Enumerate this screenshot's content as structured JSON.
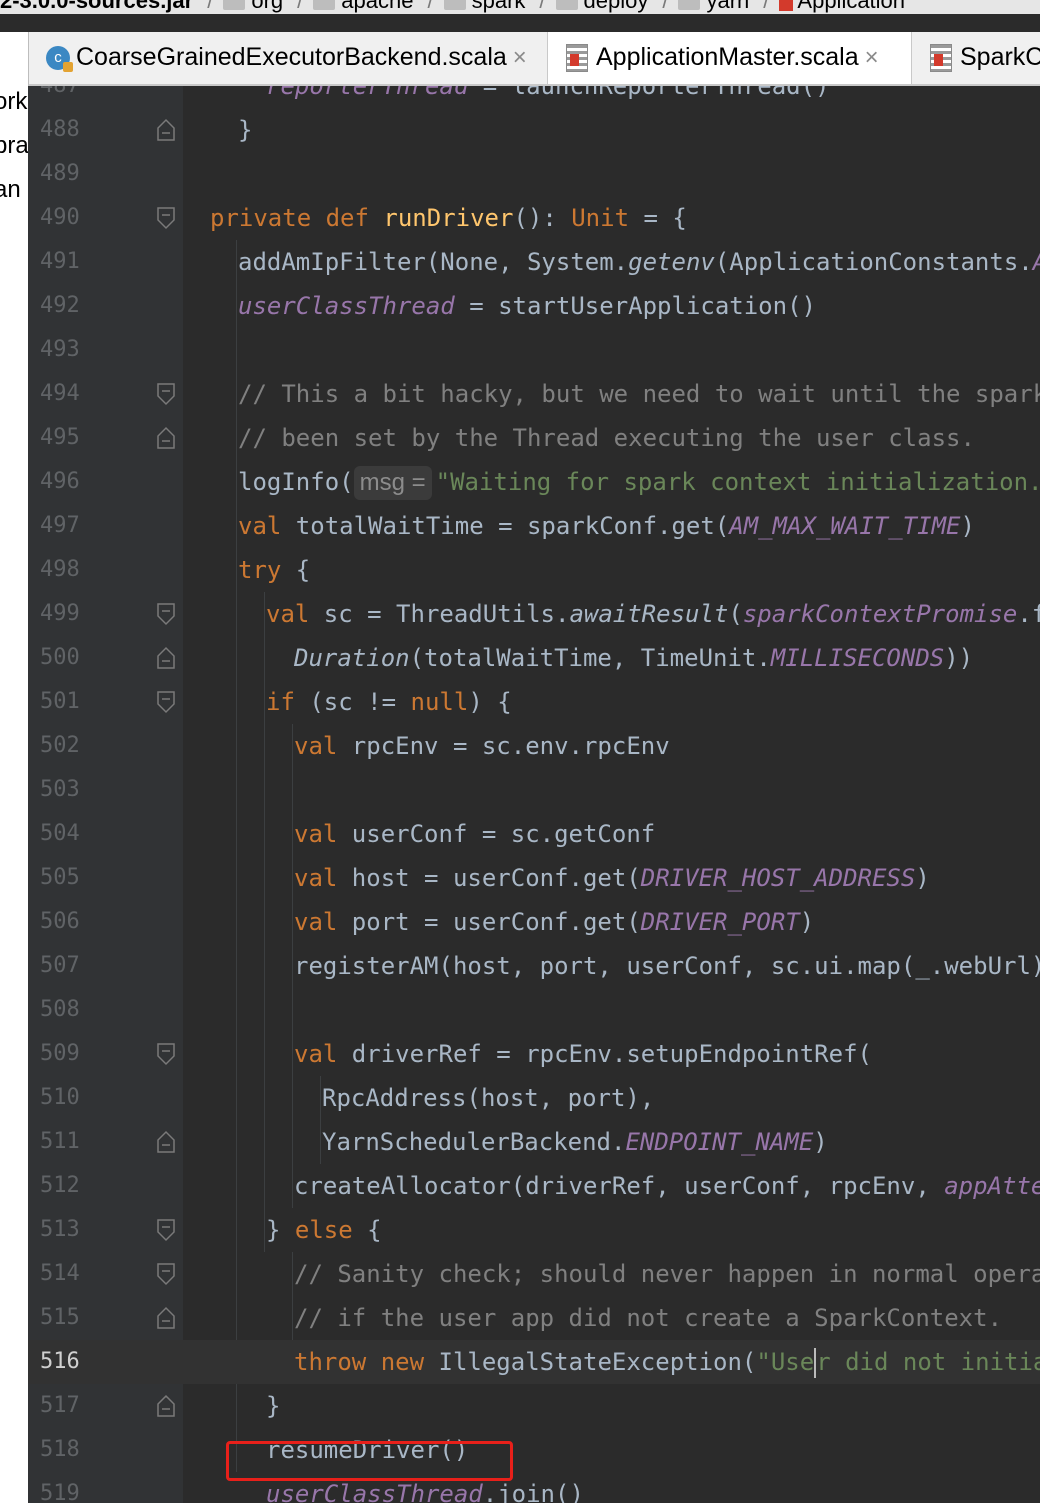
{
  "breadcrumb": {
    "items": [
      "2-3.0.0-sources.jar",
      "org",
      "apache",
      "spark",
      "deploy",
      "yarn",
      "Application"
    ]
  },
  "tabs": [
    {
      "label": "CoarseGrainedExecutorBackend.scala",
      "close": "×",
      "icon": "scala-class-icon",
      "active": false
    },
    {
      "label": "ApplicationMaster.scala",
      "close": "×",
      "icon": "scala-file-icon",
      "active": true
    },
    {
      "label": "SparkC",
      "close": "",
      "icon": "scala-file-icon",
      "active": false
    }
  ],
  "project_panel": {
    "fragments": [
      "ork",
      "bra",
      "an"
    ]
  },
  "editor": {
    "current_line": "516",
    "hint_label": "msg =",
    "lines": [
      {
        "n": "487",
        "segs": [
          [
            "fld",
            "reporterThread"
          ],
          [
            "",
            " = launchReporterThread()"
          ]
        ],
        "indent": 2
      },
      {
        "n": "488",
        "segs": [
          [
            "",
            "}"
          ]
        ],
        "indent": 1
      },
      {
        "n": "489",
        "segs": [],
        "indent": 0
      },
      {
        "n": "490",
        "segs": [
          [
            "kw",
            "private def "
          ],
          [
            "fn",
            "runDriver"
          ],
          [
            "",
            "(): "
          ],
          [
            "ty",
            "Unit"
          ],
          [
            "",
            " = {"
          ]
        ],
        "indent": 0
      },
      {
        "n": "491",
        "segs": [
          [
            "",
            "addAmIpFilter(None, System."
          ],
          [
            "it",
            "getenv"
          ],
          [
            "",
            "(ApplicationConstants."
          ],
          [
            "cst",
            "API"
          ]
        ],
        "indent": 1
      },
      {
        "n": "492",
        "segs": [
          [
            "fld",
            "userClassThread"
          ],
          [
            "",
            " = startUserApplication()"
          ]
        ],
        "indent": 1
      },
      {
        "n": "493",
        "segs": [],
        "indent": 1
      },
      {
        "n": "494",
        "segs": [
          [
            "cm",
            "// This a bit hacky, but we need to wait until the spark.d"
          ]
        ],
        "indent": 1
      },
      {
        "n": "495",
        "segs": [
          [
            "cm",
            "// been set by the Thread executing the user class."
          ]
        ],
        "indent": 1
      },
      {
        "n": "496",
        "segs": [
          [
            "",
            "logInfo("
          ],
          [
            "hint",
            "msg ="
          ],
          [
            "str",
            "\"Waiting for spark context initialization."
          ]
        ],
        "indent": 1
      },
      {
        "n": "497",
        "segs": [
          [
            "kw",
            "val "
          ],
          [
            "",
            "totalWaitTime = sparkConf.get("
          ],
          [
            "cst",
            "AM_MAX_WAIT_TIME"
          ],
          [
            "",
            ")"
          ]
        ],
        "indent": 1
      },
      {
        "n": "498",
        "segs": [
          [
            "kw",
            "try "
          ],
          [
            "",
            "{"
          ]
        ],
        "indent": 1
      },
      {
        "n": "499",
        "segs": [
          [
            "kw",
            "val "
          ],
          [
            "",
            "sc = ThreadUtils."
          ],
          [
            "it",
            "awaitResult"
          ],
          [
            "",
            "("
          ],
          [
            "fld",
            "sparkContextPromise"
          ],
          [
            "",
            ".fu"
          ]
        ],
        "indent": 2
      },
      {
        "n": "500",
        "segs": [
          [
            "it",
            "Duration"
          ],
          [
            "",
            "(totalWaitTime, TimeUnit."
          ],
          [
            "cst",
            "MILLISECONDS"
          ],
          [
            "",
            "))"
          ]
        ],
        "indent": 3
      },
      {
        "n": "501",
        "segs": [
          [
            "kw",
            "if "
          ],
          [
            "",
            "(sc != "
          ],
          [
            "kw",
            "null"
          ],
          [
            "",
            ") {"
          ]
        ],
        "indent": 2
      },
      {
        "n": "502",
        "segs": [
          [
            "kw",
            "val "
          ],
          [
            "",
            "rpcEnv = sc.env.rpcEnv"
          ]
        ],
        "indent": 3
      },
      {
        "n": "503",
        "segs": [],
        "indent": 3
      },
      {
        "n": "504",
        "segs": [
          [
            "kw",
            "val "
          ],
          [
            "",
            "userConf = sc.getConf"
          ]
        ],
        "indent": 3
      },
      {
        "n": "505",
        "segs": [
          [
            "kw",
            "val "
          ],
          [
            "",
            "host = userConf.get("
          ],
          [
            "cst",
            "DRIVER_HOST_ADDRESS"
          ],
          [
            "",
            ")"
          ]
        ],
        "indent": 3
      },
      {
        "n": "506",
        "segs": [
          [
            "kw",
            "val "
          ],
          [
            "",
            "port = userConf.get("
          ],
          [
            "cst",
            "DRIVER_PORT"
          ],
          [
            "",
            ")"
          ]
        ],
        "indent": 3
      },
      {
        "n": "507",
        "segs": [
          [
            "",
            "registerAM(host, port, userConf, sc.ui.map(_.webUrl),"
          ]
        ],
        "indent": 3
      },
      {
        "n": "508",
        "segs": [],
        "indent": 3
      },
      {
        "n": "509",
        "segs": [
          [
            "kw",
            "val "
          ],
          [
            "",
            "driverRef = rpcEnv.setupEndpointRef("
          ]
        ],
        "indent": 3
      },
      {
        "n": "510",
        "segs": [
          [
            "",
            "RpcAddress(host, port),"
          ]
        ],
        "indent": 4
      },
      {
        "n": "511",
        "segs": [
          [
            "",
            "YarnSchedulerBackend."
          ],
          [
            "cst",
            "ENDPOINT_NAME"
          ],
          [
            "",
            ")"
          ]
        ],
        "indent": 4
      },
      {
        "n": "512",
        "segs": [
          [
            "",
            "createAllocator(driverRef, userConf, rpcEnv, "
          ],
          [
            "fld",
            "appAttem"
          ]
        ],
        "indent": 3
      },
      {
        "n": "513",
        "segs": [
          [
            "",
            "} "
          ],
          [
            "kw",
            "else "
          ],
          [
            "",
            "{"
          ]
        ],
        "indent": 2
      },
      {
        "n": "514",
        "segs": [
          [
            "cm",
            "// Sanity check; should never happen in normal operati"
          ]
        ],
        "indent": 3
      },
      {
        "n": "515",
        "segs": [
          [
            "cm",
            "// if the user app did not create a SparkContext."
          ]
        ],
        "indent": 3
      },
      {
        "n": "516",
        "segs": [
          [
            "kw",
            "throw new "
          ],
          [
            "",
            "IllegalStateException("
          ],
          [
            "str",
            "\"Use"
          ],
          [
            "caret",
            ""
          ],
          [
            "str",
            "r did not initial"
          ]
        ],
        "indent": 3
      },
      {
        "n": "517",
        "segs": [
          [
            "",
            "}"
          ]
        ],
        "indent": 2
      },
      {
        "n": "518",
        "segs": [
          [
            "",
            "resumeDriver()"
          ]
        ],
        "indent": 2
      },
      {
        "n": "519",
        "segs": [
          [
            "fld",
            "userClassThread"
          ],
          [
            "",
            ".join()"
          ]
        ],
        "indent": 2
      }
    ]
  },
  "annotation": {
    "color": "#e8201a",
    "target_line": "518"
  },
  "colors": {
    "keyword": "#cc7832",
    "function": "#ffc66d",
    "string": "#6a8759",
    "comment": "#808080",
    "constant": "#9876aa",
    "text": "#a9b7c6",
    "gutter": "#313335",
    "background": "#2b2b2b"
  }
}
